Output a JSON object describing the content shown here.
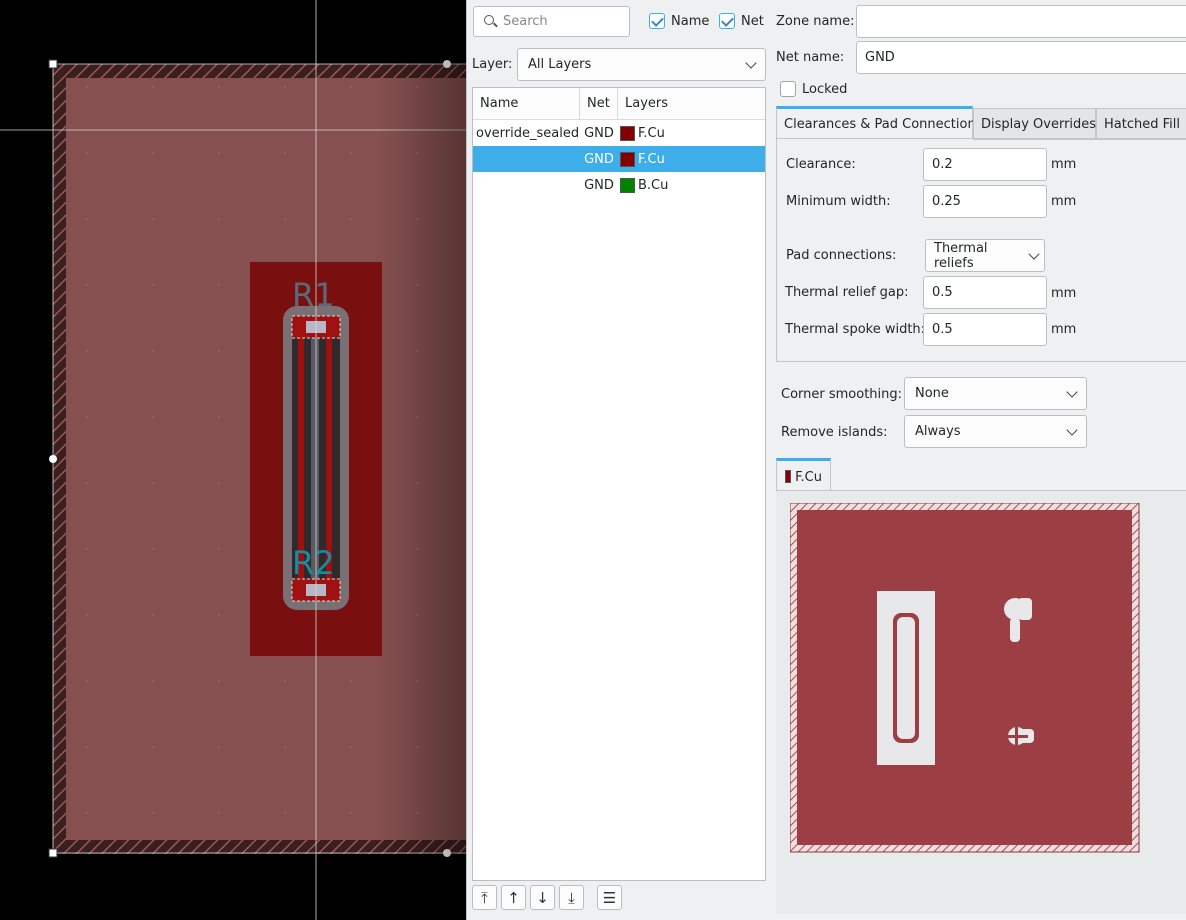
{
  "canvas": {
    "ref_r1": "R1",
    "ref_r2": "R2"
  },
  "search": {
    "placeholder": "Search"
  },
  "filters": {
    "name_label": "Name",
    "net_label": "Net"
  },
  "layer_filter": {
    "label": "Layer:",
    "value": "All Layers"
  },
  "zone_table": {
    "headers": {
      "name": "Name",
      "net": "Net",
      "layers": "Layers"
    },
    "rows": [
      {
        "name": "override_sealed",
        "net": "GND",
        "layer": "F.Cu",
        "color": "#840000",
        "selected": false
      },
      {
        "name": "",
        "net": "GND",
        "layer": "F.Cu",
        "color": "#840000",
        "selected": true
      },
      {
        "name": "",
        "net": "GND",
        "layer": "B.Cu",
        "color": "#008400",
        "selected": false
      }
    ]
  },
  "form": {
    "zone_name_label": "Zone name:",
    "zone_name_value": "",
    "net_name_label": "Net name:",
    "net_name_value": "GND",
    "locked_label": "Locked"
  },
  "tabs": {
    "clearances": "Clearances & Pad Connections",
    "display_overrides": "Display Overrides",
    "hatched_fill": "Hatched Fill"
  },
  "clearances": {
    "clearance_label": "Clearance:",
    "clearance_value": "0.2",
    "clearance_unit": "mm",
    "min_width_label": "Minimum width:",
    "min_width_value": "0.25",
    "min_width_unit": "mm",
    "pad_conn_label": "Pad connections:",
    "pad_conn_value": "Thermal reliefs",
    "relief_gap_label": "Thermal relief gap:",
    "relief_gap_value": "0.5",
    "relief_gap_unit": "mm",
    "spoke_width_label": "Thermal spoke width:",
    "spoke_width_value": "0.5",
    "spoke_width_unit": "mm"
  },
  "corner": {
    "label": "Corner smoothing:",
    "value": "None"
  },
  "islands": {
    "label": "Remove islands:",
    "value": "Always"
  },
  "preview": {
    "tab_label": "F.Cu",
    "tab_color": "#840000",
    "copper_color": "#9b3f45"
  },
  "colors": {
    "accent": "#3daee9",
    "zone_fill": "#85504f",
    "copper": "#840000"
  }
}
